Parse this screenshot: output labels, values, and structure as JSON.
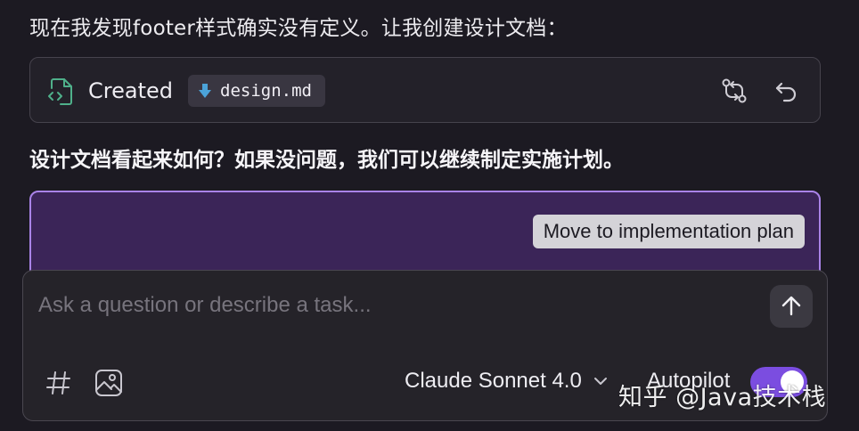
{
  "colors": {
    "background": "#1c1a22",
    "accent_purple": "#7b4de0",
    "plan_box_bg": "#3b2558",
    "plan_box_border": "#a983e8"
  },
  "messages": {
    "intro": "现在我发现footer样式确实没有定义。让我创建设计文档：",
    "question": "设计文档看起来如何？如果没问题，我们可以继续制定实施计划。"
  },
  "file_card": {
    "status": "Created",
    "icon": "file-code-icon",
    "file_name": "design.md",
    "file_icon": "download-arrow-icon",
    "actions": [
      "compare-icon",
      "revert-icon"
    ]
  },
  "plan_box": {
    "button_label": "Move to implementation plan"
  },
  "composer": {
    "placeholder": "Ask a question or describe a task...",
    "send_icon": "arrow-up-icon",
    "tools": [
      "hash-icon",
      "image-icon"
    ],
    "model": "Claude Sonnet 4.0",
    "autopilot_label": "Autopilot",
    "autopilot_on": true
  },
  "watermark": "知乎 @Java技术栈"
}
